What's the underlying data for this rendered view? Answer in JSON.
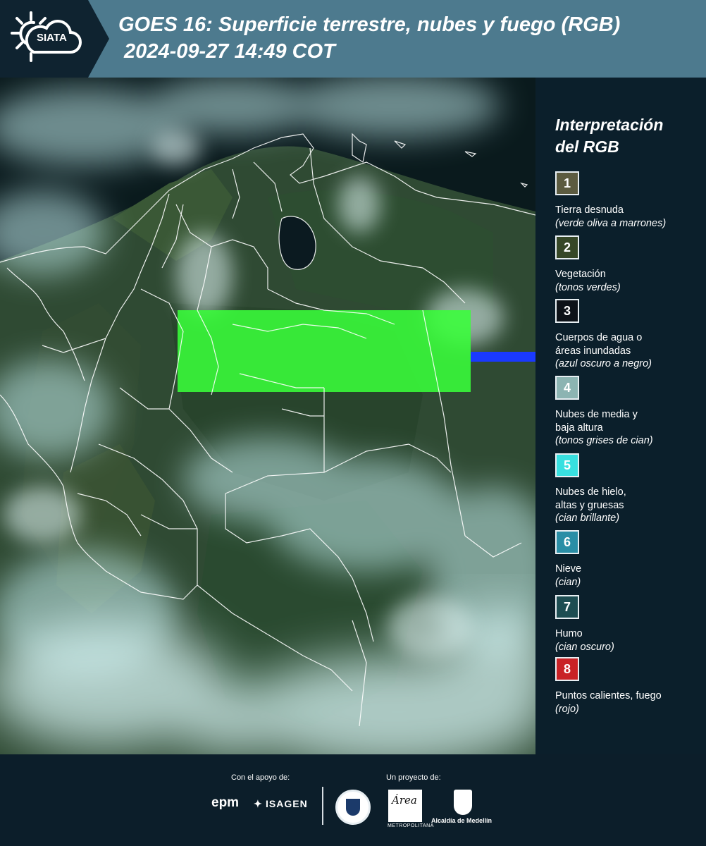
{
  "header": {
    "logo_text": "SIATA",
    "title_line1": "GOES 16: Superficie terrestre, nubes y fuego (RGB)",
    "title_line2": " 2024-09-27 14:49 COT",
    "background_color": "#4d7a8e",
    "logo_panel_color": "#0f2330"
  },
  "legend": {
    "title_line1": "Interpretación",
    "title_line2": "del RGB",
    "items": [
      {
        "number": "1",
        "label_line1": "Tierra desnuda",
        "label_line2": "",
        "note": "(verde oliva a marrones)",
        "color": "#5c5b40"
      },
      {
        "number": "2",
        "label_line1": "Vegetación",
        "label_line2": "",
        "note": "(tonos verdes)",
        "color": "#364727"
      },
      {
        "number": "3",
        "label_line1": "Cuerpos de agua o",
        "label_line2": "áreas inundadas",
        "note": "(azul oscuro a negro)",
        "color": "#0d1218"
      },
      {
        "number": "4",
        "label_line1": "Nubes de media y",
        "label_line2": "baja altura",
        "note": "(tonos grises de cian)",
        "color": "#8cb4b2"
      },
      {
        "number": "5",
        "label_line1": "Nubes de hielo,",
        "label_line2": "altas y gruesas",
        "note": "(cian brillante)",
        "color": "#38e0e0"
      },
      {
        "number": "6",
        "label_line1": "Nieve",
        "label_line2": "",
        "note": "(cian)",
        "color": "#2a8ea6"
      },
      {
        "number": "7",
        "label_line1": "Humo",
        "label_line2": "",
        "note": "(cian oscuro)",
        "color": "#1d4d52"
      },
      {
        "number": "8",
        "label_line1": "Puntos calientes, fuego",
        "label_line2": "",
        "note": "(rojo)",
        "color": "#c92226"
      }
    ]
  },
  "footer": {
    "support_label": "Con el apoyo de:",
    "project_label": "Un proyecto de:",
    "sponsor1": "epm",
    "sponsor2": "ISAGEN",
    "partner_area_logo": "Área",
    "partner_area_text": "METROPOLITANA",
    "partner_medellin": "Alcaldía de Medellín"
  },
  "map": {
    "highlight_color": "#39ff3a",
    "missing_scan_color": "#1a39ff",
    "border_color": "#ffffff"
  }
}
